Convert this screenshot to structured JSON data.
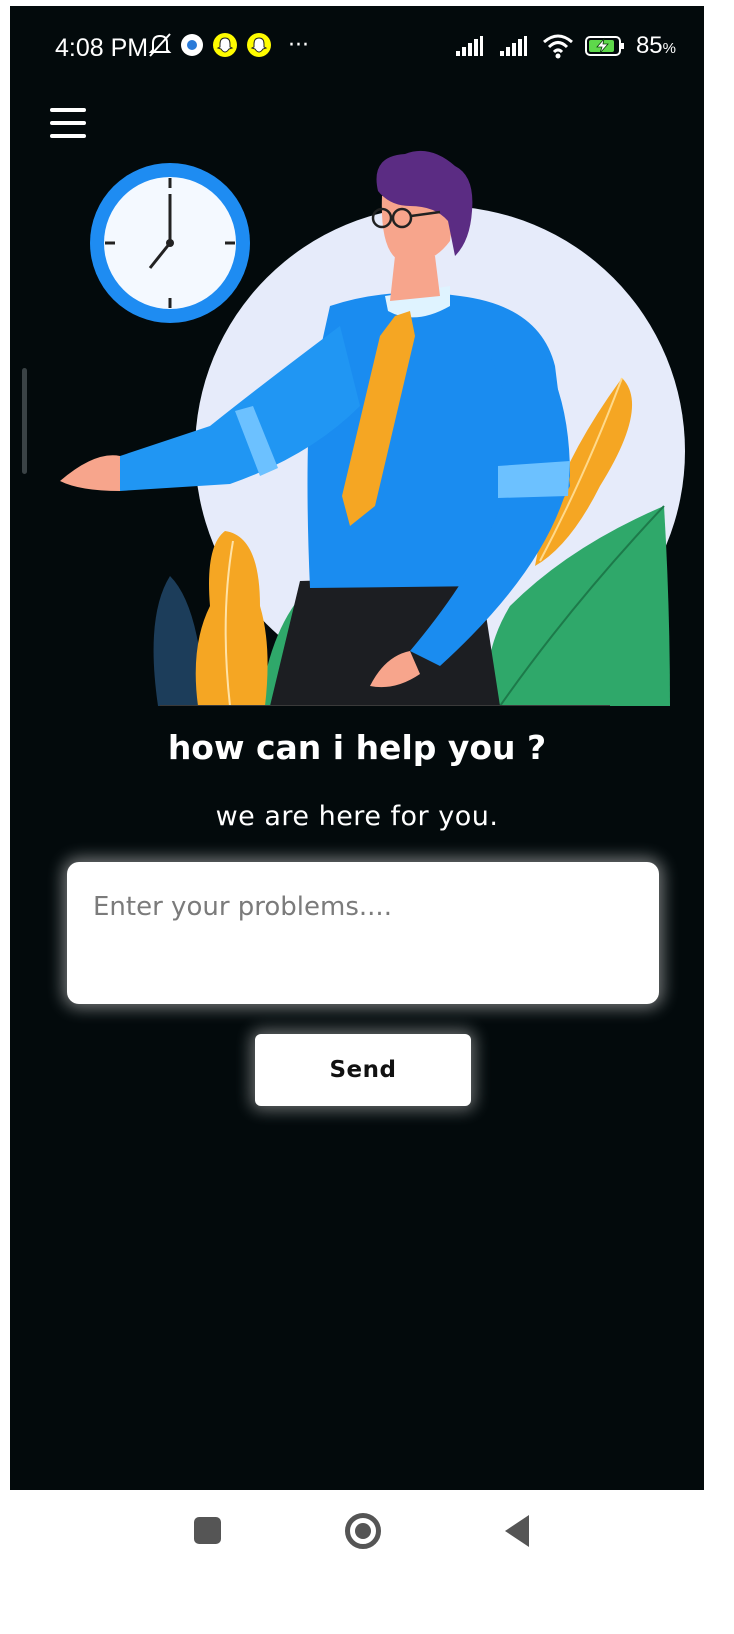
{
  "status_bar": {
    "time": "4:08 PM",
    "battery": "85",
    "battery_unit": "%",
    "more": "···",
    "icons": [
      "mute-bell-icon",
      "settings-app-icon",
      "snapchat-icon",
      "snapchat-icon",
      "signal-icon",
      "signal-icon",
      "wifi-icon",
      "battery-charging-icon"
    ]
  },
  "menu": {
    "icon": "hamburger-menu-icon"
  },
  "illustration": {
    "subject": "support-agent-illustration"
  },
  "headline": "how can i help you ?",
  "subline": "we are here for you.",
  "input": {
    "placeholder": "Enter your problems....",
    "value": ""
  },
  "send_button": {
    "label": "Send"
  },
  "nav_bar": {
    "icons": [
      "recent-apps-icon",
      "home-icon",
      "back-icon"
    ]
  },
  "colors": {
    "background": "#030a0c",
    "shirt_blue": "#1a8cf0",
    "tie_orange": "#f5a623",
    "hair_purple": "#5b2c83",
    "leaf_green": "#2fa86a",
    "clock_blue": "#1e8cf2"
  }
}
